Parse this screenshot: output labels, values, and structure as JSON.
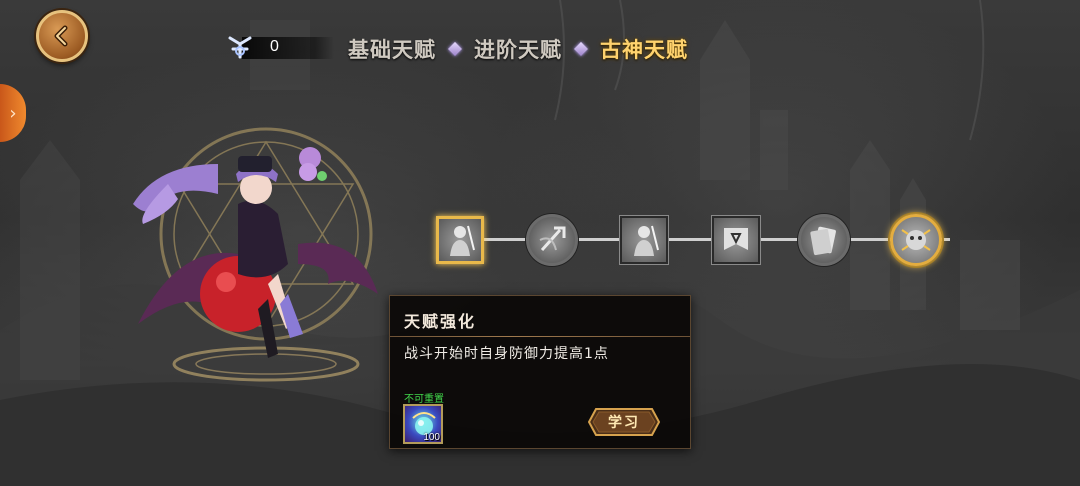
{
  "header": {
    "back_icon": "back-arrow-icon",
    "currency": {
      "icon": "rune-icon",
      "value": "0"
    },
    "tabs": [
      {
        "label": "基础天赋",
        "active": false
      },
      {
        "label": "进阶天赋",
        "active": false
      },
      {
        "label": "古神天赋",
        "active": true
      }
    ],
    "active_tab_color": "#ffd36e"
  },
  "side_tab": {
    "icon": "chevron-right-icon"
  },
  "talent_chain": {
    "nodes": [
      {
        "shape": "square",
        "icon": "warrior-portrait-icon",
        "selected": true
      },
      {
        "shape": "circle",
        "icon": "weapon-icon",
        "selected": false
      },
      {
        "shape": "square",
        "icon": "warrior-portrait-icon",
        "selected": false
      },
      {
        "shape": "square",
        "icon": "banner-icon",
        "selected": false
      },
      {
        "shape": "circle",
        "icon": "card-icon",
        "selected": false
      },
      {
        "shape": "circle",
        "icon": "ancient-god-icon",
        "selected": false,
        "gold": true
      }
    ]
  },
  "tooltip": {
    "title": "天赋强化",
    "description": "战斗开始时自身防御力提高1点",
    "note": "不可重置",
    "note_color": "#41d84b",
    "cost_item": {
      "icon": "crystal-orb-icon",
      "count": "100"
    },
    "learn_label": "学习"
  }
}
